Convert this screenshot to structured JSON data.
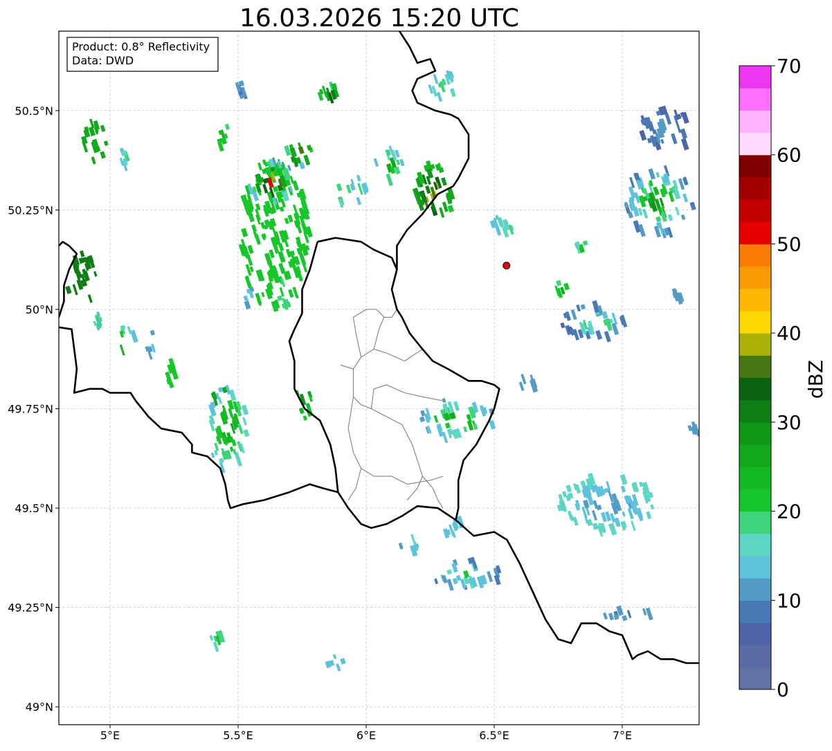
{
  "map": {
    "title": "16.03.2026 15:20 UTC",
    "info_box": {
      "product_line": "Product: 0.8° Reflectivity",
      "data_line": "Data: DWD"
    },
    "lon_range": [
      4.8,
      7.3
    ],
    "lat_range": [
      48.955,
      50.7
    ],
    "lon_ticks": [
      {
        "value": 5.0,
        "label": "5°E"
      },
      {
        "value": 5.5,
        "label": "5.5°E"
      },
      {
        "value": 6.0,
        "label": "6°E"
      },
      {
        "value": 6.5,
        "label": "6.5°E"
      },
      {
        "value": 7.0,
        "label": "7°E"
      }
    ],
    "lat_ticks": [
      {
        "value": 50.5,
        "label": "50.5°N"
      },
      {
        "value": 50.25,
        "label": "50.25°N"
      },
      {
        "value": 50.0,
        "label": "50°N"
      },
      {
        "value": 49.75,
        "label": "49.75°N"
      },
      {
        "value": 49.5,
        "label": "49.5°N"
      },
      {
        "value": 49.25,
        "label": "49.25°N"
      },
      {
        "value": 49.0,
        "label": "49°N"
      }
    ],
    "grid": true,
    "radar_marker": {
      "lon": 6.548,
      "lat": 50.11,
      "color": "#e8000b"
    },
    "borders": [
      [
        [
          4.8,
          50.16
        ],
        [
          4.815,
          50.17
        ],
        [
          4.84,
          50.16
        ],
        [
          4.87,
          50.14
        ],
        [
          4.84,
          50.1
        ],
        [
          4.82,
          50.06
        ],
        [
          4.82,
          50.02
        ],
        [
          4.8,
          49.98
        ]
      ],
      [
        [
          4.8,
          49.955
        ],
        [
          4.85,
          49.95
        ],
        [
          4.86,
          49.9
        ],
        [
          4.87,
          49.85
        ],
        [
          4.86,
          49.79
        ],
        [
          4.92,
          49.8
        ],
        [
          4.97,
          49.8
        ],
        [
          5.0,
          49.79
        ],
        [
          5.08,
          49.79
        ],
        [
          5.1,
          49.77
        ],
        [
          5.15,
          49.73
        ],
        [
          5.2,
          49.7
        ],
        [
          5.28,
          49.69
        ],
        [
          5.32,
          49.66
        ],
        [
          5.32,
          49.64
        ],
        [
          5.38,
          49.63
        ],
        [
          5.43,
          49.6
        ],
        [
          5.45,
          49.56
        ],
        [
          5.46,
          49.52
        ],
        [
          5.47,
          49.5
        ],
        [
          5.52,
          49.51
        ],
        [
          5.6,
          49.52
        ],
        [
          5.7,
          49.54
        ],
        [
          5.78,
          49.56
        ],
        [
          5.83,
          49.55
        ],
        [
          5.89,
          49.54
        ],
        [
          5.93,
          49.5
        ],
        [
          5.98,
          49.46
        ],
        [
          6.02,
          49.45
        ],
        [
          6.08,
          49.46
        ],
        [
          6.14,
          49.48
        ],
        [
          6.2,
          49.505
        ],
        [
          6.28,
          49.5
        ],
        [
          6.35,
          49.47
        ],
        [
          6.42,
          49.43
        ],
        [
          6.5,
          49.44
        ],
        [
          6.55,
          49.42
        ],
        [
          6.6,
          49.36
        ],
        [
          6.65,
          49.29
        ],
        [
          6.7,
          49.22
        ],
        [
          6.75,
          49.17
        ],
        [
          6.8,
          49.16
        ],
        [
          6.84,
          49.21
        ],
        [
          6.9,
          49.21
        ],
        [
          6.95,
          49.19
        ],
        [
          7.0,
          49.18
        ],
        [
          7.04,
          49.12
        ],
        [
          7.06,
          49.13
        ],
        [
          7.1,
          49.14
        ],
        [
          7.15,
          49.12
        ],
        [
          7.2,
          49.12
        ],
        [
          7.25,
          49.11
        ],
        [
          7.3,
          49.11
        ]
      ],
      [
        [
          6.13,
          50.7
        ],
        [
          6.17,
          50.66
        ],
        [
          6.2,
          50.62
        ],
        [
          6.25,
          50.63
        ],
        [
          6.27,
          50.6
        ],
        [
          6.2,
          50.58
        ],
        [
          6.18,
          50.55
        ],
        [
          6.2,
          50.52
        ],
        [
          6.27,
          50.5
        ],
        [
          6.33,
          50.49
        ],
        [
          6.36,
          50.48
        ],
        [
          6.4,
          50.44
        ],
        [
          6.4,
          50.38
        ],
        [
          6.36,
          50.33
        ],
        [
          6.34,
          50.31
        ],
        [
          6.28,
          50.29
        ],
        [
          6.22,
          50.24
        ],
        [
          6.16,
          50.2
        ],
        [
          6.12,
          50.16
        ],
        [
          6.12,
          50.1
        ],
        [
          6.1,
          50.05
        ],
        [
          6.12,
          50.0
        ],
        [
          6.14,
          49.98
        ],
        [
          6.17,
          49.94
        ],
        [
          6.22,
          49.9
        ],
        [
          6.26,
          49.87
        ],
        [
          6.32,
          49.85
        ],
        [
          6.4,
          49.82
        ],
        [
          6.45,
          49.82
        ],
        [
          6.5,
          49.81
        ],
        [
          6.52,
          49.8
        ],
        [
          6.5,
          49.75
        ],
        [
          6.48,
          49.72
        ],
        [
          6.43,
          49.66
        ],
        [
          6.38,
          49.62
        ],
        [
          6.36,
          49.57
        ],
        [
          6.36,
          49.5
        ],
        [
          6.35,
          49.47
        ]
      ],
      [
        [
          5.81,
          50.17
        ],
        [
          5.88,
          50.18
        ],
        [
          5.98,
          50.17
        ],
        [
          6.03,
          50.15
        ],
        [
          6.1,
          50.13
        ],
        [
          6.12,
          50.1
        ]
      ],
      [
        [
          5.81,
          50.17
        ],
        [
          5.78,
          50.1
        ],
        [
          5.75,
          50.05
        ],
        [
          5.75,
          49.99
        ],
        [
          5.72,
          49.95
        ],
        [
          5.7,
          49.92
        ],
        [
          5.72,
          49.87
        ],
        [
          5.72,
          49.8
        ],
        [
          5.76,
          49.75
        ],
        [
          5.82,
          49.72
        ],
        [
          5.86,
          49.66
        ],
        [
          5.88,
          49.6
        ],
        [
          5.89,
          49.54
        ]
      ]
    ],
    "subregions": [
      [
        [
          5.9,
          49.86
        ],
        [
          5.95,
          49.85
        ],
        [
          5.98,
          49.88
        ],
        [
          6.03,
          49.9
        ],
        [
          6.08,
          49.89
        ],
        [
          6.15,
          49.87
        ],
        [
          6.22,
          49.9
        ]
      ],
      [
        [
          5.98,
          49.88
        ],
        [
          5.96,
          49.94
        ],
        [
          5.95,
          49.98
        ],
        [
          6.0,
          50.0
        ],
        [
          6.04,
          50.0
        ],
        [
          6.07,
          49.98
        ]
      ],
      [
        [
          6.03,
          49.9
        ],
        [
          6.05,
          49.95
        ],
        [
          6.07,
          49.98
        ],
        [
          6.1,
          49.98
        ],
        [
          6.12,
          50.0
        ]
      ],
      [
        [
          5.95,
          49.85
        ],
        [
          5.95,
          49.78
        ],
        [
          5.98,
          49.76
        ],
        [
          6.02,
          49.75
        ],
        [
          6.08,
          49.73
        ],
        [
          6.14,
          49.71
        ]
      ],
      [
        [
          6.02,
          49.75
        ],
        [
          6.03,
          49.8
        ],
        [
          6.08,
          49.81
        ],
        [
          6.15,
          49.79
        ],
        [
          6.22,
          49.78
        ],
        [
          6.3,
          49.77
        ]
      ],
      [
        [
          6.14,
          49.71
        ],
        [
          6.18,
          49.66
        ],
        [
          6.2,
          49.62
        ],
        [
          6.22,
          49.58
        ],
        [
          6.2,
          49.55
        ],
        [
          6.16,
          49.52
        ]
      ],
      [
        [
          5.95,
          49.78
        ],
        [
          5.93,
          49.7
        ],
        [
          5.95,
          49.64
        ],
        [
          5.98,
          49.6
        ],
        [
          5.96,
          49.55
        ],
        [
          5.93,
          49.52
        ]
      ],
      [
        [
          5.98,
          49.6
        ],
        [
          6.03,
          49.58
        ],
        [
          6.1,
          49.58
        ],
        [
          6.16,
          49.56
        ],
        [
          6.25,
          49.57
        ],
        [
          6.3,
          49.58
        ]
      ],
      [
        [
          6.22,
          49.58
        ],
        [
          6.26,
          49.55
        ],
        [
          6.28,
          49.52
        ],
        [
          6.3,
          49.5
        ]
      ]
    ],
    "cells": [
      [
        4.88,
        50.08,
        22,
        38,
        12,
        12
      ],
      [
        4.93,
        50.43,
        18,
        30,
        10,
        10
      ],
      [
        5.05,
        50.39,
        7,
        12,
        5,
        8
      ],
      [
        5.05,
        49.93,
        12,
        22,
        5,
        15
      ],
      [
        5.23,
        49.85,
        10,
        20,
        8,
        8
      ],
      [
        5.45,
        49.71,
        30,
        60,
        5,
        12
      ],
      [
        5.42,
        49.79,
        10,
        18,
        10,
        10
      ],
      [
        5.5,
        50.56,
        8,
        8,
        4,
        2
      ],
      [
        5.43,
        50.44,
        10,
        20,
        7,
        10
      ],
      [
        5.63,
        50.2,
        50,
        110,
        8,
        8
      ],
      [
        5.67,
        50.05,
        10,
        25,
        8,
        5
      ],
      [
        5.73,
        50.4,
        25,
        20,
        4,
        20
      ],
      [
        5.75,
        49.79,
        10,
        35,
        8,
        14
      ],
      [
        5.53,
        50.04,
        6,
        15,
        4,
        6
      ],
      [
        5.85,
        50.55,
        20,
        15,
        6,
        15
      ],
      [
        5.62,
        50.33,
        35,
        30,
        4,
        20
      ],
      [
        5.96,
        50.31,
        10,
        18,
        5,
        8
      ],
      [
        6.08,
        50.37,
        20,
        25,
        5,
        12
      ],
      [
        6.25,
        50.3,
        30,
        45,
        8,
        18
      ],
      [
        6.3,
        50.57,
        25,
        20,
        5,
        8
      ],
      [
        6.55,
        50.22,
        25,
        15,
        5,
        8
      ],
      [
        7.15,
        50.46,
        40,
        30,
        2,
        5
      ],
      [
        7.13,
        50.28,
        50,
        50,
        3,
        12
      ],
      [
        7.2,
        50.05,
        10,
        12,
        4,
        4
      ],
      [
        6.88,
        49.98,
        50,
        25,
        2,
        10
      ],
      [
        6.75,
        50.06,
        12,
        12,
        5,
        12
      ],
      [
        6.84,
        50.16,
        15,
        10,
        5,
        10
      ],
      [
        6.62,
        49.82,
        10,
        12,
        4,
        4
      ],
      [
        6.35,
        49.73,
        55,
        28,
        4,
        12
      ],
      [
        6.93,
        49.52,
        70,
        40,
        6,
        3
      ],
      [
        6.38,
        49.34,
        50,
        22,
        3,
        8
      ],
      [
        6.16,
        49.42,
        15,
        12,
        4,
        10
      ],
      [
        5.42,
        49.18,
        15,
        15,
        6,
        8
      ],
      [
        5.86,
        49.12,
        15,
        10,
        5,
        5
      ],
      [
        7.01,
        49.24,
        35,
        8,
        4,
        3
      ],
      [
        7.28,
        49.71,
        12,
        8,
        4,
        4
      ],
      [
        6.34,
        49.46,
        20,
        15,
        5,
        5
      ],
      [
        5.9,
        50.3,
        12,
        15,
        6,
        10
      ],
      [
        4.94,
        49.98,
        6,
        10,
        5,
        8
      ],
      [
        5.15,
        49.92,
        8,
        15,
        4,
        6
      ]
    ],
    "colorbar": {
      "label": "dBZ",
      "min": 0,
      "max": 70,
      "ticks": [
        {
          "value": 0,
          "label": "0"
        },
        {
          "value": 10,
          "label": "10"
        },
        {
          "value": 20,
          "label": "20"
        },
        {
          "value": 30,
          "label": "30"
        },
        {
          "value": 40,
          "label": "40"
        },
        {
          "value": 50,
          "label": "50"
        },
        {
          "value": 60,
          "label": "60"
        },
        {
          "value": 70,
          "label": "70"
        }
      ],
      "colors": [
        "#6272a4",
        "#5a6ba6",
        "#4f63a8",
        "#4a7ab5",
        "#549bc6",
        "#5fc2dc",
        "#5ed6c4",
        "#3ed47c",
        "#17c62a",
        "#14b823",
        "#12a81c",
        "#0f9818",
        "#0c7e14",
        "#0a6410",
        "#487811",
        "#a9b204",
        "#fcd700",
        "#fbb702",
        "#fa9a02",
        "#fb7c02",
        "#e70000",
        "#c50000",
        "#a50000",
        "#810000",
        "#ffdcff",
        "#ffb3ff",
        "#ff6efe",
        "#ec36f1"
      ]
    }
  }
}
